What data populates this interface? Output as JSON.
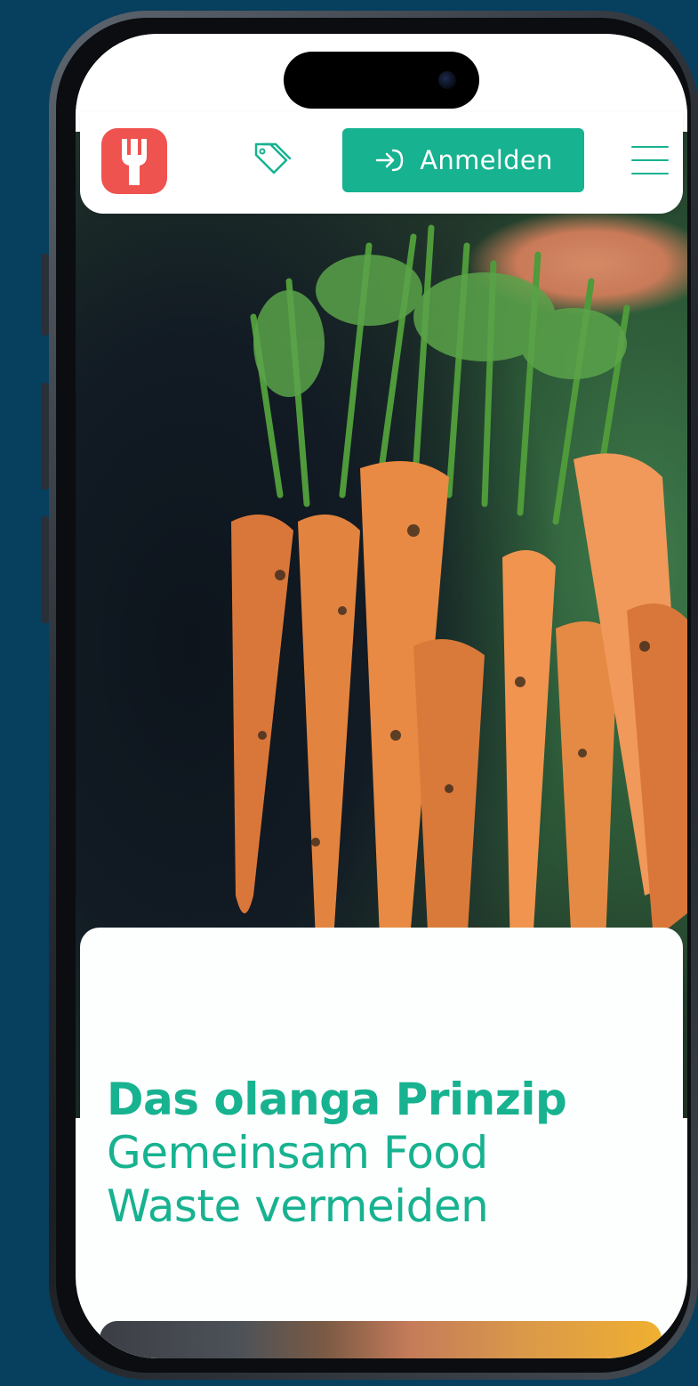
{
  "header": {
    "logo_name": "fork-logo",
    "login_label": "Anmelden"
  },
  "hero": {
    "title_bold": "Das olanga Prinzip",
    "title_line2": "Gemeinsam Food",
    "title_line3": "Waste vermeiden"
  },
  "colors": {
    "brand_green": "#17b290",
    "logo_red": "#ef5350",
    "background": "#073f5e"
  },
  "icons": [
    "tag-icon",
    "login-arrow-icon",
    "hamburger-menu-icon"
  ]
}
